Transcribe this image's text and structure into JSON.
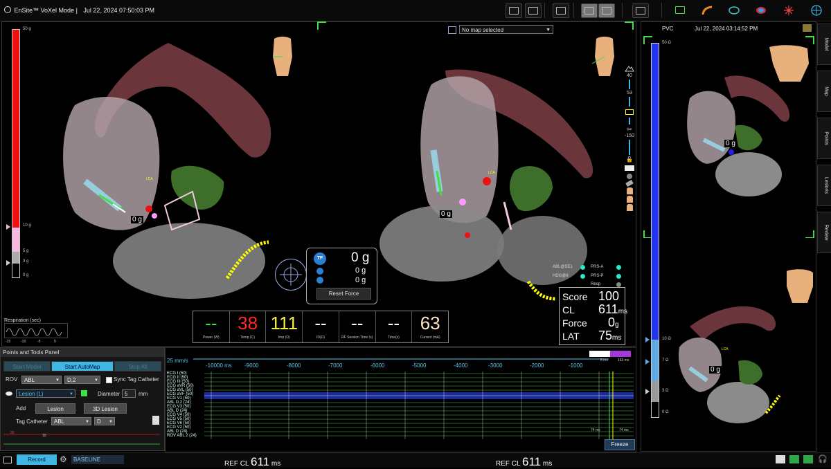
{
  "topbar": {
    "brand": "EnSite™ VoXel Mode |",
    "datetime": "Jul 22, 2024 07:50:03 PM"
  },
  "main": {
    "force_scale": {
      "top": "50 g",
      "mid": "10 g",
      "p5": "5 g",
      "p3": "3 g",
      "zero": "0 g"
    },
    "map_selector": "No map selected",
    "force_tag_left": "0 g",
    "force_tag_right": "0 g",
    "lca_left": "LCA",
    "lca_right": "LCA",
    "slider": {
      "v1": "40",
      "v2": "53",
      "v3": "-150"
    },
    "contact_force": {
      "badge": "TF",
      "total": "0 g",
      "lateral": "0 g",
      "axial": "0 g",
      "reset_label": "Reset Force"
    },
    "legend": [
      {
        "label": "ABL@SE1",
        "color": "#2ee6c8"
      },
      {
        "label": "HDG@8",
        "color": "#2ee6c8"
      },
      {
        "label": "PRS-A",
        "color": "#2ee6c8"
      },
      {
        "label": "PRS-P",
        "color": "#2ee6c8"
      },
      {
        "label": "Resp",
        "color": "#888888"
      }
    ],
    "score": {
      "score_label": "Score",
      "score_value": "100",
      "cl_label": "CL",
      "cl_value": "611",
      "cl_unit": "ms",
      "force_label": "Force",
      "force_value": "0",
      "force_unit": "g",
      "lat_label": "LAT",
      "lat_value": "75",
      "lat_unit": "ms"
    },
    "respiration": {
      "label": "Respiration (sec)",
      "ticks": [
        "-15",
        "-10",
        "-5",
        "0"
      ]
    }
  },
  "params": [
    {
      "value": "--",
      "label": "Power (W)",
      "color": "#3fe046"
    },
    {
      "value": "38",
      "label": "Temp (C)",
      "color": "#ff2a2a"
    },
    {
      "value": "111",
      "label": "Imp (Ω)",
      "color": "#f6f23a"
    },
    {
      "value": "--",
      "label": "ID(Ω)",
      "color": "#ffffff"
    },
    {
      "value": "--",
      "label": "RF Session Time (s)",
      "color": "#ffffff"
    },
    {
      "value": "--",
      "label": "Time(s)",
      "color": "#ffffff"
    },
    {
      "value": "63",
      "label": "Current (mA)",
      "color": "#ffe6c8"
    }
  ],
  "panel": {
    "title": "Points and Tools Panel",
    "start_model": "Start Model",
    "start_automap": "Start AutoMap",
    "stop_all": "Stop All",
    "rov_label": "ROV",
    "rov_value": "ABL",
    "rov_electrode": "D,2",
    "sync_label": "Sync Tag Catheter",
    "lesion_type": "Lesion (L)",
    "diameter_label": "Diameter",
    "diameter_value": "5",
    "diameter_unit": "mm",
    "add_label": "Add",
    "lesion_btn": "Lesion",
    "lesion3d_btn": "3D Lesion",
    "tag_catheter_label": "Tag Catheter",
    "tag_catheter_value": "ABL",
    "tag_electrode": "D",
    "mini_scale": {
      "a": "20",
      "b": "10"
    }
  },
  "ecg": {
    "speed": "25 mm/s",
    "ticks": [
      "-10000 ms",
      "-9000",
      "-8000",
      "-7000",
      "-6000",
      "-5000",
      "-4000",
      "-3000",
      "-2000",
      "-1000"
    ],
    "leads": [
      "ECG I (50)",
      "ECG II (50)",
      "ECG III (50)",
      "ECG aVR (50)",
      "ECG aVL (50)",
      "ECG aVF (50)",
      "ECG V1 (50)",
      "ABL D,2 (24)",
      "ECG V3 (50)",
      "ABL D (24)",
      "ECG V4 (50)",
      "ECG V5 (50)",
      "ECG V6 (50)",
      "ECG V2 (50)",
      "ABL D (24)",
      "ROV ABL 2 (24)"
    ],
    "marker_a": "5 ms",
    "marker_b": "163 ms",
    "tail_a": "74 ms",
    "tail_b": "74 ms",
    "freeze": "Freeze"
  },
  "rview": {
    "title": "PVC",
    "datetime": "Jul 22, 2024 03:14:52 PM",
    "scale": {
      "top": "50 Ω",
      "mid": "10 Ω",
      "p7": "7 Ω",
      "p3": "3 Ω",
      "zero": "0 Ω"
    },
    "force_tag": "0 g",
    "force_tag2": "0 g",
    "lca": "LCA"
  },
  "side_tabs": [
    "Model",
    "Map",
    "Points",
    "Lesions",
    "Review"
  ],
  "bottombar": {
    "record": "Record",
    "baseline": "BASELINE",
    "ref1": {
      "ref": "REF",
      "cl": "CL",
      "value": "611",
      "unit": "ms"
    },
    "ref2": {
      "ref": "REF",
      "cl": "CL",
      "value": "611",
      "unit": "ms"
    }
  }
}
